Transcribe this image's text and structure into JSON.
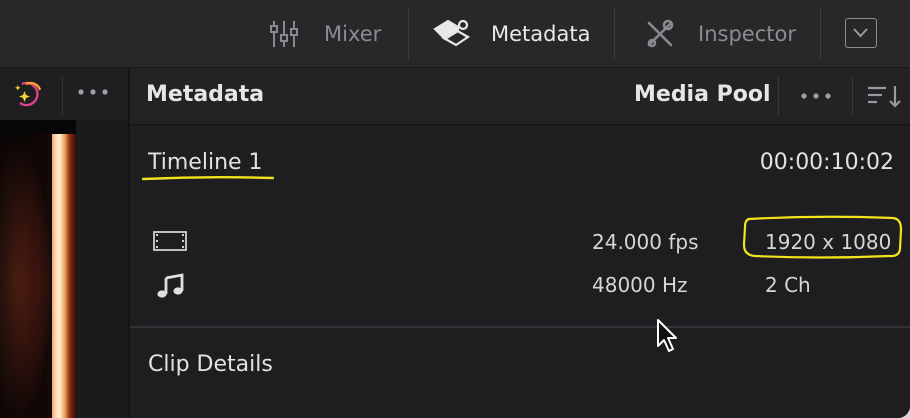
{
  "toolbar": {
    "items": [
      {
        "label": "Mixer",
        "icon": "mixer-sliders-icon",
        "active": false
      },
      {
        "label": "Metadata",
        "icon": "metadata-tag-icon",
        "active": true
      },
      {
        "label": "Inspector",
        "icon": "inspector-tools-icon",
        "active": false
      }
    ],
    "dropdown_icon": "chevron-down-icon"
  },
  "left_panel": {
    "effects_icon": "color-sparkle-icon",
    "more_icon": "more-dots-icon"
  },
  "panel": {
    "title": "Metadata",
    "mode": "Media Pool",
    "more_icon": "more-dots-icon",
    "sort_icon": "sort-icon"
  },
  "timeline": {
    "name": "Timeline 1",
    "duration": "00:00:10:02"
  },
  "video": {
    "icon": "film-strip-icon",
    "fps": "24.000 fps",
    "resolution": "1920 x 1080"
  },
  "audio": {
    "icon": "music-note-icon",
    "sample_rate": "48000 Hz",
    "channels": "2 Ch"
  },
  "section": {
    "title": "Clip Details"
  },
  "colors": {
    "annotation": "#f2e31b",
    "background": "#1e1e21",
    "toolbar": "#28282b",
    "text": "#e2e2e2"
  }
}
